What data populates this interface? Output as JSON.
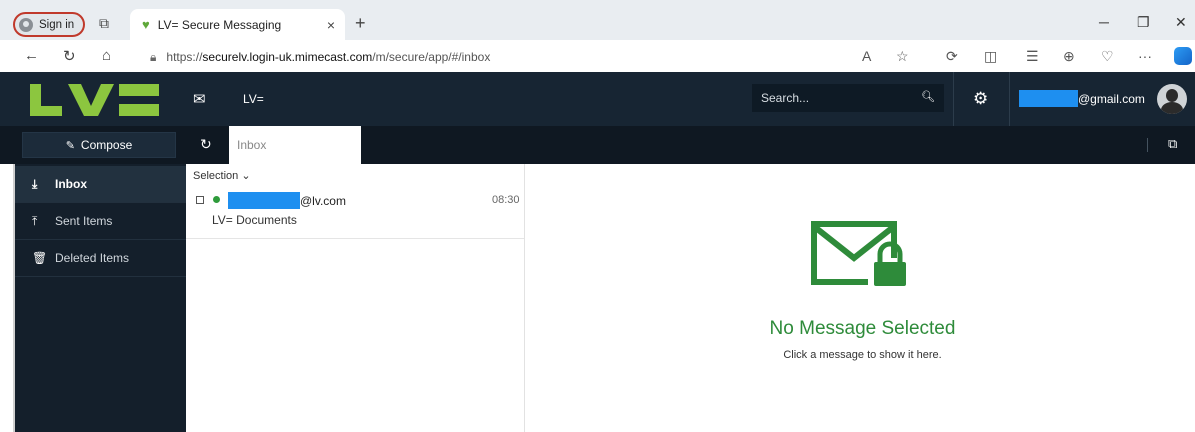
{
  "browser": {
    "signin_label": "Sign in",
    "tab_title": "LV= Secure Messaging",
    "tab_close": "×",
    "new_tab": "+",
    "url_prefix": "https://",
    "url_host": "securelv.login-uk.mimecast.com",
    "url_path": "/m/secure/app/#/inbox"
  },
  "app": {
    "logo_text": "LV=",
    "title": "LV=",
    "search_placeholder": "Search...",
    "user_email_suffix": "@gmail.com",
    "compose_label": "Compose",
    "inbox_tab_label": "Inbox"
  },
  "sidebar": {
    "items": [
      {
        "label": "Inbox",
        "icon": "inbox-download-icon",
        "active": true
      },
      {
        "label": "Sent Items",
        "icon": "sent-upload-icon",
        "active": false
      },
      {
        "label": "Deleted Items",
        "icon": "trash-icon",
        "active": false
      }
    ]
  },
  "list": {
    "selection_label": "Selection",
    "messages": [
      {
        "sender_suffix": "@lv.com",
        "time": "08:30",
        "subject": "LV= Documents",
        "unread": true
      }
    ]
  },
  "reading": {
    "empty_title": "No Message Selected",
    "empty_hint": "Click a message to show it here."
  },
  "colors": {
    "header_bg": "#172533",
    "sidebar_bg": "#141f2b",
    "brand_green": "#8cc63f",
    "status_green": "#2e8b3a",
    "redaction_blue": "#1e8ff0"
  }
}
